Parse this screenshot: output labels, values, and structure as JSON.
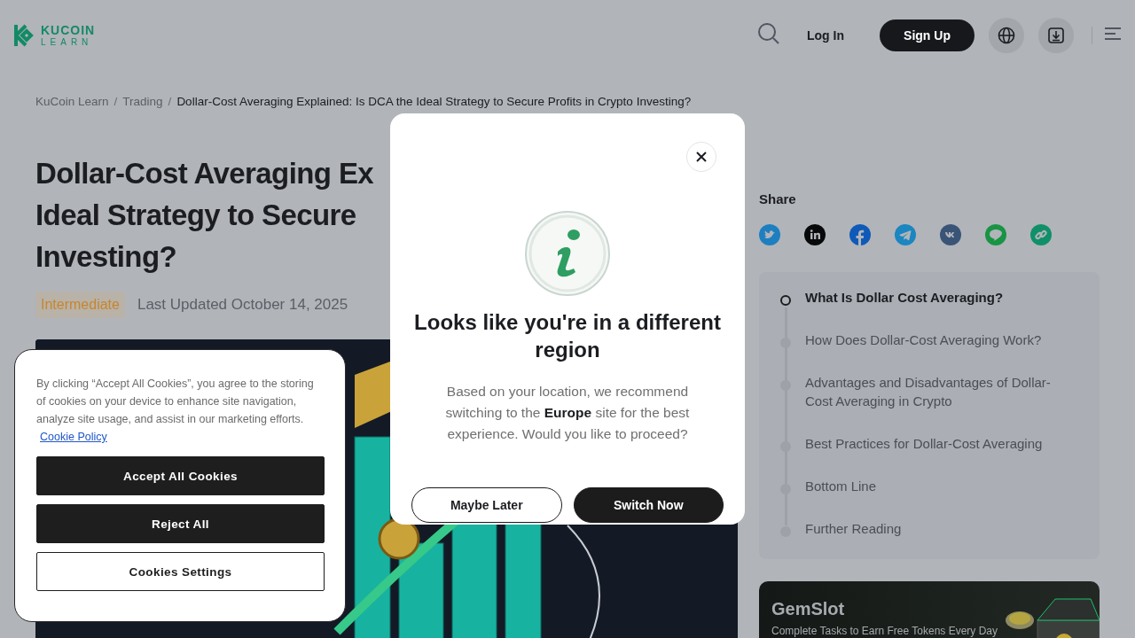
{
  "header": {
    "logo_text": "KUCOIN",
    "logo_subtext": "LEARN",
    "login": "Log In",
    "signup": "Sign Up"
  },
  "breadcrumb": [
    {
      "kind": "link",
      "text": "KuCoin Learn"
    },
    {
      "kind": "separator",
      "text": "/"
    },
    {
      "kind": "link",
      "text": "Trading"
    },
    {
      "kind": "separator",
      "text": "/"
    },
    {
      "kind": "current",
      "text": "Dollar-Cost Averaging Explained: Is DCA the Ideal Strategy to Secure Profits in Crypto Investing?"
    }
  ],
  "article": {
    "title_lines": [
      "Dollar-Cost Averaging Ex",
      "Ideal Strategy to Secure",
      "Investing?"
    ],
    "level_badge": "Intermediate",
    "updated": "Last Updated October 14, 2025"
  },
  "share": {
    "label": "Share"
  },
  "toc": [
    {
      "text": "What Is Dollar Cost Averaging?",
      "selected": true
    },
    {
      "text": "How Does Dollar-Cost Averaging Work?",
      "selected": false
    },
    {
      "text": "Advantages and Disadvantages of Dollar-Cost Averaging in Crypto",
      "selected": false
    },
    {
      "text": "Best Practices for Dollar-Cost Averaging",
      "selected": false
    },
    {
      "text": "Bottom Line",
      "selected": false
    },
    {
      "text": "Further Reading",
      "selected": false
    }
  ],
  "promo": {
    "title": "GemSlot",
    "subtitle": "Complete Tasks to Earn Free Tokens Every Day"
  },
  "region_modal": {
    "title": "Looks like you're in a different region",
    "body": "Based on your location, we recommend switching to the **Europe** site for the best experience. Would you like to proceed?",
    "buttons": [
      {
        "label": "Maybe Later",
        "kind": "outline"
      },
      {
        "label": "Switch Now",
        "kind": "filled"
      }
    ]
  },
  "cookie_banner": {
    "text": "By clicking “Accept All Cookies”, you agree to the storing of cookies on your device to enhance site navigation, analyze site usage, and assist in our marketing efforts.",
    "link": "Cookie Policy",
    "buttons": [
      {
        "label": "Accept All Cookies",
        "kind": "filled"
      },
      {
        "label": "Reject All",
        "kind": "filled"
      },
      {
        "label": "Cookies Settings",
        "kind": "outline"
      }
    ]
  }
}
